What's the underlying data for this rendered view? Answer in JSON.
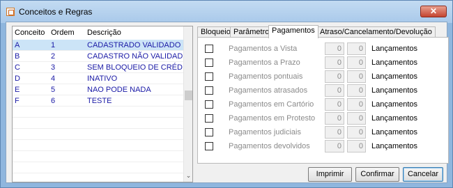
{
  "window": {
    "title": "Conceitos e Regras",
    "close_glyph": "✕"
  },
  "list": {
    "columns": [
      "Conceito",
      "Ordem",
      "Descrição"
    ],
    "rows": [
      {
        "conceito": "A",
        "ordem": "1",
        "descricao": "CADASTRADO VALIDADO"
      },
      {
        "conceito": "B",
        "ordem": "2",
        "descricao": "CADASTRO NÃO VALIDAD"
      },
      {
        "conceito": "C",
        "ordem": "3",
        "descricao": "SEM BLOQUEIO DE CRÉD"
      },
      {
        "conceito": "D",
        "ordem": "4",
        "descricao": "INATIVO"
      },
      {
        "conceito": "E",
        "ordem": "5",
        "descricao": "NAO PODE NADA"
      },
      {
        "conceito": "F",
        "ordem": "6",
        "descricao": "TESTE"
      }
    ],
    "scroll_down_glyph": "⌄"
  },
  "tabs": [
    "Bloqueios",
    "Parâmetros",
    "Pagamentos",
    "Atraso/Cancelamento/Devolução"
  ],
  "active_tab": "Pagamentos",
  "payments": {
    "lancamentos_label": "Lançamentos",
    "rows": [
      {
        "label": "Pagamentos a Vista",
        "value1": "0",
        "value2": "0",
        "checked": false
      },
      {
        "label": "Pagamentos a Prazo",
        "value1": "0",
        "value2": "0",
        "checked": false
      },
      {
        "label": "Pagamentos pontuais",
        "value1": "0",
        "value2": "0",
        "checked": false
      },
      {
        "label": "Pagamentos atrasados",
        "value1": "0",
        "value2": "0",
        "checked": false
      },
      {
        "label": "Pagamentos em Cartório",
        "value1": "0",
        "value2": "0",
        "checked": false
      },
      {
        "label": "Pagamentos em Protesto",
        "value1": "0",
        "value2": "0",
        "checked": false
      },
      {
        "label": "Pagamentos judiciais",
        "value1": "0",
        "value2": "0",
        "checked": false
      },
      {
        "label": "Pagamentos devolvidos",
        "value1": "0",
        "value2": "0",
        "checked": false
      }
    ]
  },
  "buttons": {
    "print": "Imprimir",
    "confirm": "Confirmar",
    "cancel": "Cancelar"
  },
  "colors": {
    "selected_row": "#cce4f7",
    "list_text": "#1a1aa6",
    "title_bar": "#b5d0ec"
  }
}
